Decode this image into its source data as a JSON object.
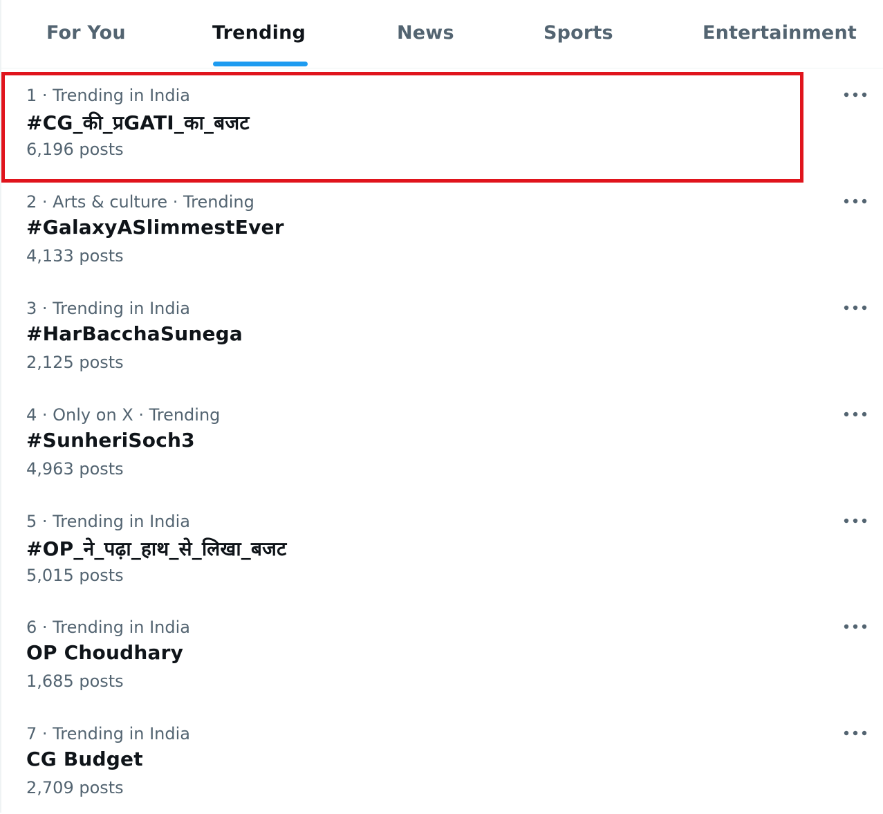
{
  "tabs": [
    {
      "label": "For You",
      "active": false
    },
    {
      "label": "Trending",
      "active": true
    },
    {
      "label": "News",
      "active": false
    },
    {
      "label": "Sports",
      "active": false
    },
    {
      "label": "Entertainment",
      "active": false
    }
  ],
  "colors": {
    "accent": "#1d9bf0",
    "highlight": "#e0141c",
    "text_primary": "#0f1419",
    "text_secondary": "#536471"
  },
  "trends": [
    {
      "meta": "1 · Trending in India",
      "title": "#CG_की_प्रGATI_का_बजट",
      "count": "6,196 posts",
      "highlighted": true
    },
    {
      "meta": "2 · Arts & culture · Trending",
      "title": "#GalaxyASlimmestEver",
      "count": "4,133 posts",
      "highlighted": false
    },
    {
      "meta": "3 · Trending in India",
      "title": "#HarBacchaSunega",
      "count": "2,125 posts",
      "highlighted": false
    },
    {
      "meta": "4 · Only on X · Trending",
      "title": "#SunheriSoch3",
      "count": "4,963 posts",
      "highlighted": false
    },
    {
      "meta": "5 · Trending in India",
      "title": "#OP_ने_पढ़ा_हाथ_से_लिखा_बजट",
      "count": "5,015 posts",
      "highlighted": false
    },
    {
      "meta": "6 · Trending in India",
      "title": "OP Choudhary",
      "count": "1,685 posts",
      "highlighted": false
    },
    {
      "meta": "7 · Trending in India",
      "title": "CG Budget",
      "count": "2,709 posts",
      "highlighted": false
    }
  ],
  "icons": {
    "more": "more-horizontal-icon"
  }
}
